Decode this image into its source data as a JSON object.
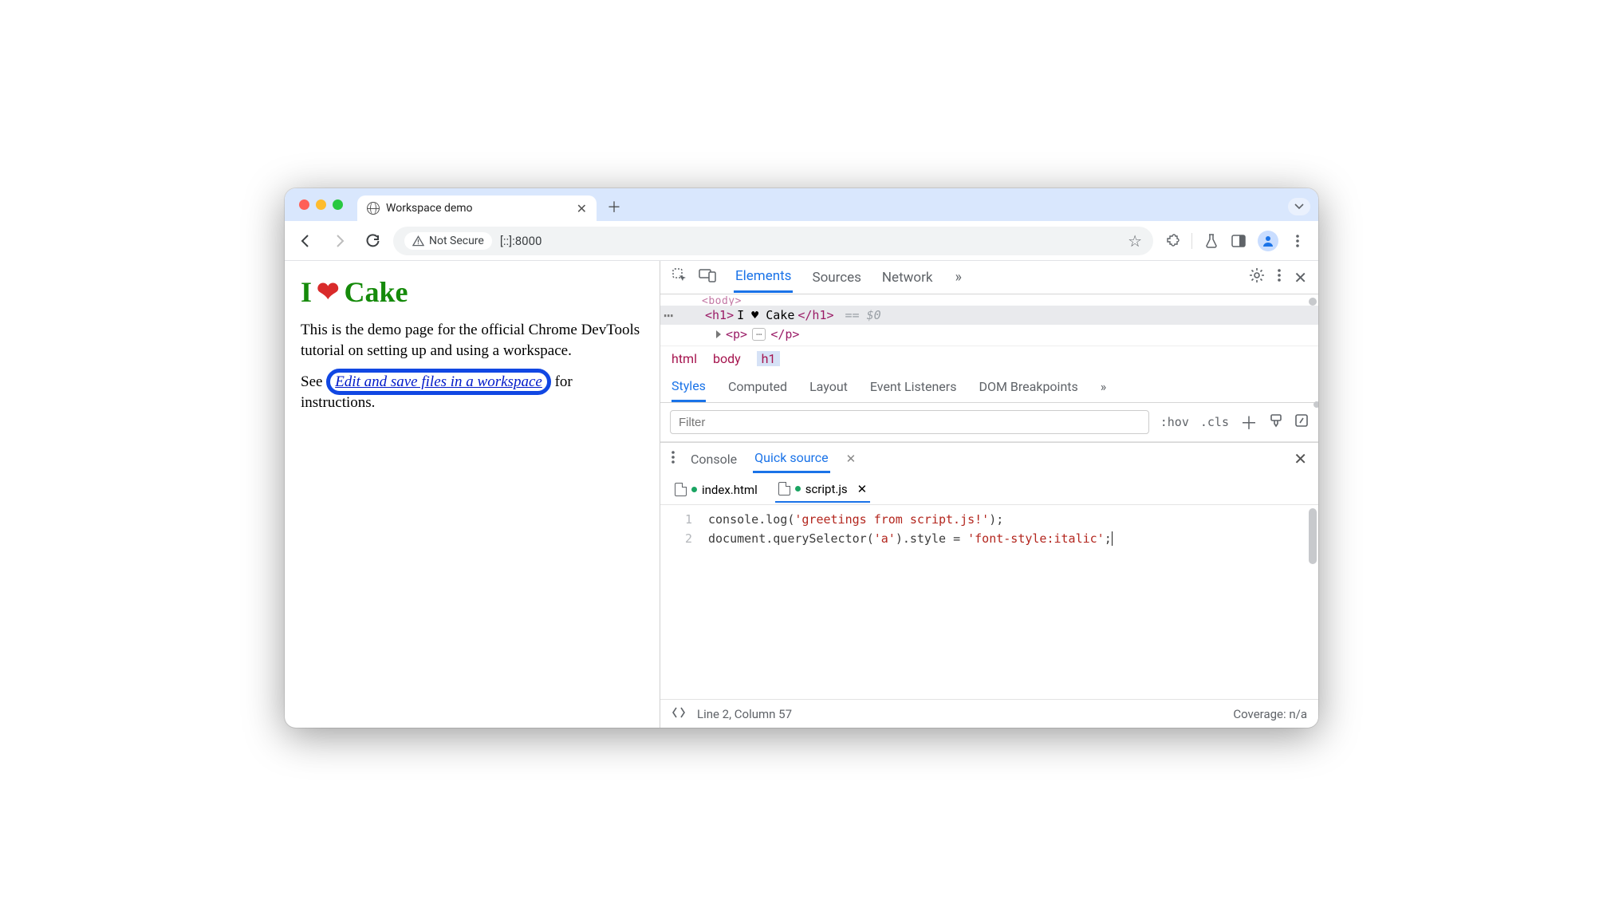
{
  "browser": {
    "tab_title": "Workspace demo",
    "security_label": "Not Secure",
    "url": "[::]:8000"
  },
  "page": {
    "heading_i": "I",
    "heading_cake": "Cake",
    "para1": "This is the demo page for the official Chrome DevTools tutorial on setting up and using a workspace.",
    "para2_pre": "See ",
    "link": "Edit and save files in a workspace",
    "para2_post": " for instructions."
  },
  "devtools": {
    "tabs": {
      "elements": "Elements",
      "sources": "Sources",
      "network": "Network",
      "more": "»"
    },
    "elements": {
      "body_open": "<body>",
      "h1_open": "<h1>",
      "h1_text": "I ♥ Cake",
      "h1_close": "</h1>",
      "eq": "== $0",
      "p_open": "<p>",
      "p_close": "</p>",
      "crumbs": {
        "html": "html",
        "body": "body",
        "h1": "h1"
      }
    },
    "subtabs": {
      "styles": "Styles",
      "computed": "Computed",
      "layout": "Layout",
      "listeners": "Event Listeners",
      "dom": "DOM Breakpoints",
      "more": "»"
    },
    "styles": {
      "filter_placeholder": "Filter",
      "hov": ":hov",
      "cls": ".cls"
    },
    "drawer": {
      "console": "Console",
      "quick": "Quick source",
      "file1": "index.html",
      "file2": "script.js",
      "code_line1": "console.log('greetings from script.js!');",
      "code_line2": "document.querySelector('a').style = 'font-style:italic';",
      "status": "Line 2, Column 57",
      "coverage": "Coverage: n/a"
    }
  }
}
